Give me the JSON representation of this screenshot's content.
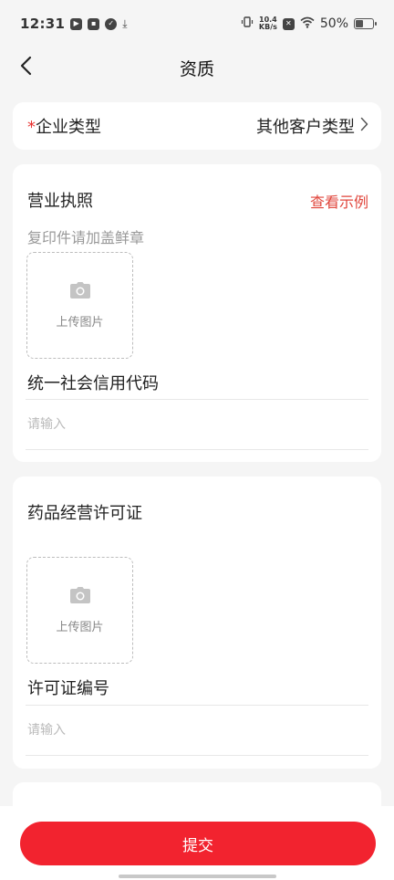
{
  "status_bar": {
    "time": "12:31",
    "net_speed_value": "10.4",
    "net_speed_unit": "KB/s",
    "battery_text": "50%"
  },
  "header": {
    "title": "资质"
  },
  "enterprise_type": {
    "required_mark": "*",
    "label": "企业类型",
    "value": "其他客户类型"
  },
  "business_license": {
    "title": "营业执照",
    "example_link": "查看示例",
    "hint": "复印件请加盖鲜章",
    "upload_label": "上传图片",
    "code_label": "统一社会信用代码",
    "code_placeholder": "请输入"
  },
  "drug_license": {
    "title": "药品经营许可证",
    "upload_label": "上传图片",
    "number_label": "许可证编号",
    "number_placeholder": "请输入"
  },
  "footer": {
    "submit_label": "提交"
  },
  "colors": {
    "accent": "#f2232f",
    "link": "#e0463c",
    "background": "#f5f5f5"
  }
}
